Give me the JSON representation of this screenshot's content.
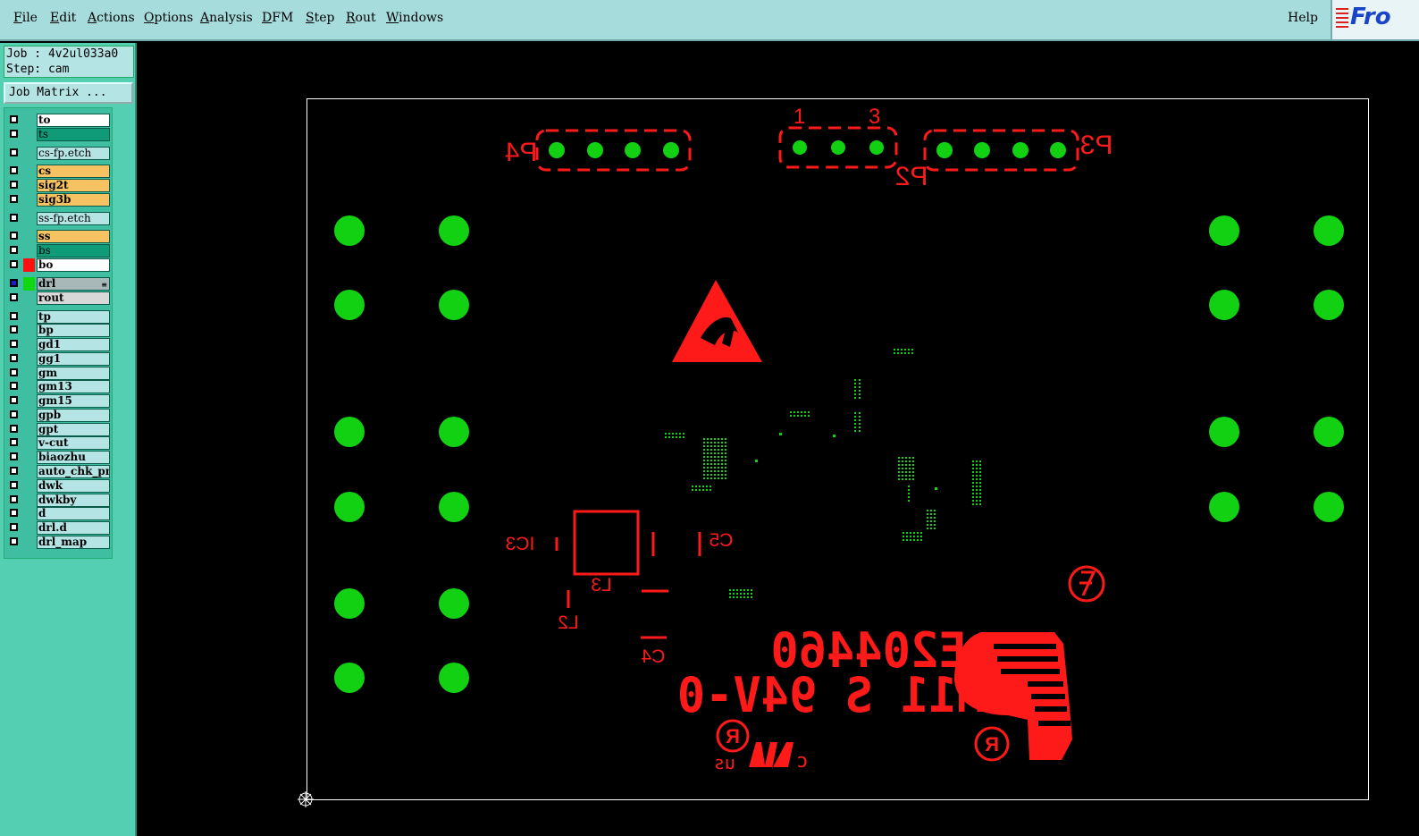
{
  "menubar": {
    "items": [
      {
        "label": "File",
        "u": "F",
        "rest": "ile"
      },
      {
        "label": "Edit",
        "u": "E",
        "rest": "dit"
      },
      {
        "label": "Actions",
        "u": "A",
        "rest": "ctions"
      },
      {
        "label": "Options",
        "u": "O",
        "rest": "ptions"
      },
      {
        "label": "Analysis",
        "u": "A",
        "rest": "nalysis"
      },
      {
        "label": "DFM",
        "u": "D",
        "rest": "FM"
      },
      {
        "label": "Step",
        "u": "S",
        "rest": "tep"
      },
      {
        "label": "Rout",
        "u": "R",
        "rest": "out"
      },
      {
        "label": "Windows",
        "u": "W",
        "rest": "indows"
      }
    ],
    "help": "Help",
    "brand": "Fro"
  },
  "job": {
    "job_line": "Job : 4v2ul033a0",
    "step_line": "Step: cam",
    "matrix_button": "Job Matrix ..."
  },
  "layers": [
    {
      "name": "to",
      "color": "#ffffff",
      "bold": true
    },
    {
      "name": "ts",
      "color": "#0f9a78",
      "bold": false
    },
    {
      "name": "cs-fp.etch",
      "color": "#b4e4e4",
      "bold": false
    },
    {
      "name": "cs",
      "color": "#f7c261",
      "bold": true
    },
    {
      "name": "sig2t",
      "color": "#f7c261",
      "bold": true
    },
    {
      "name": "sig3b",
      "color": "#f7c261",
      "bold": true
    },
    {
      "name": "ss-fp.etch",
      "color": "#b4e4e4",
      "bold": false
    },
    {
      "name": "ss",
      "color": "#f7c261",
      "bold": true
    },
    {
      "name": "bs",
      "color": "#0f9a78",
      "bold": false
    },
    {
      "name": "bo",
      "color": "#ffffff",
      "bold": true,
      "swatch": "#ff1010"
    },
    {
      "name": "drl",
      "color": "#a8b8b8",
      "bold": true,
      "swatch": "#10d810",
      "selected": true
    },
    {
      "name": "rout",
      "color": "#d8d8d8",
      "bold": true
    },
    {
      "name": "tp",
      "color": "#b4e4e4",
      "bold": true
    },
    {
      "name": "bp",
      "color": "#b4e4e4",
      "bold": true
    },
    {
      "name": "gd1",
      "color": "#b4e4e4",
      "bold": true
    },
    {
      "name": "gg1",
      "color": "#b4e4e4",
      "bold": true
    },
    {
      "name": "gm",
      "color": "#b4e4e4",
      "bold": true
    },
    {
      "name": "gm13",
      "color": "#b4e4e4",
      "bold": true
    },
    {
      "name": "gm15",
      "color": "#b4e4e4",
      "bold": true
    },
    {
      "name": "gpb",
      "color": "#b4e4e4",
      "bold": true
    },
    {
      "name": "gpt",
      "color": "#b4e4e4",
      "bold": true
    },
    {
      "name": "v-cut",
      "color": "#b4e4e4",
      "bold": true
    },
    {
      "name": "biaozhu",
      "color": "#b4e4e4",
      "bold": true
    },
    {
      "name": "auto_chk_pn",
      "color": "#b4e4e4",
      "bold": true
    },
    {
      "name": "dwk",
      "color": "#b4e4e4",
      "bold": true
    },
    {
      "name": "dwkby",
      "color": "#b4e4e4",
      "bold": true
    },
    {
      "name": "d",
      "color": "#b4e4e4",
      "bold": true
    },
    {
      "name": "drl.d",
      "color": "#b4e4e4",
      "bold": true
    },
    {
      "name": "drl_map",
      "color": "#b4e4e4",
      "bold": true
    }
  ],
  "board": {
    "connectors": [
      {
        "label": "P4",
        "pins": 4
      },
      {
        "label": "P2",
        "pins": 3,
        "pin_labels": [
          "1",
          "3"
        ]
      },
      {
        "label": "P3",
        "pins": 4
      }
    ],
    "components": [
      "IC3",
      "C5",
      "L3",
      "L2",
      "C4"
    ],
    "ul_marking": {
      "file_number": "E204460",
      "rating": "M11 S 94V-0",
      "c_mark": "c",
      "us_mark": "us"
    },
    "colors": {
      "silkscreen": "#ff1a1a",
      "drill": "#12d012",
      "outline": "#ffffff"
    }
  }
}
